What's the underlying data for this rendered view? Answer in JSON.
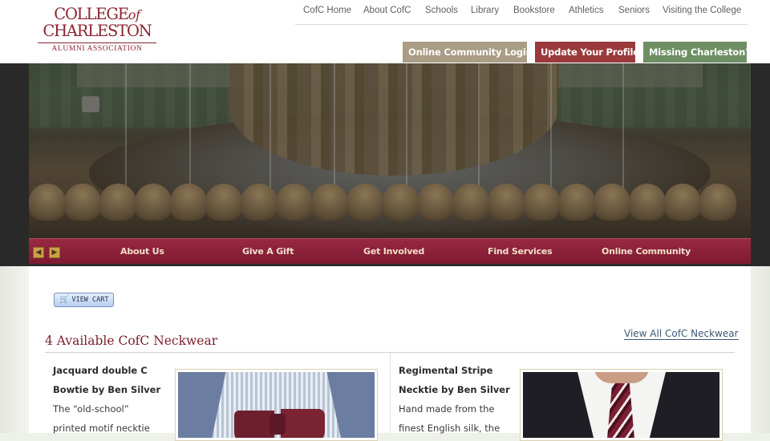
{
  "header": {
    "logo": {
      "line1_main": "COLLEGE",
      "line1_of": "of",
      "line2": "CHARLESTON",
      "sub": "ALUMNI ASSOCIATION"
    },
    "top_nav": [
      "CofC Home",
      "About CofC",
      "Schools",
      "Library",
      "Bookstore",
      "Athletics",
      "Seniors",
      "Visiting the College"
    ],
    "buttons": {
      "login": "Online Community Login",
      "update": "Update Your Profile",
      "missing": "Missing Charleston?"
    },
    "button_colors": {
      "login": "#a99d85",
      "update": "#9b3a3c",
      "missing": "#6e8f63"
    }
  },
  "hero": {
    "prev_icon": "arrow-left-icon",
    "next_icon": "arrow-right-icon"
  },
  "main_nav": [
    "About Us",
    "Give A Gift",
    "Get Involved",
    "Find Services",
    "Online Community"
  ],
  "content": {
    "view_cart": "VIEW CART",
    "section_title": "4 Available CofC Neckwear",
    "view_all": "View All CofC Neckwear",
    "products": [
      {
        "name_lines": [
          "Jacquard double C",
          "Bowtie by Ben Silver"
        ],
        "desc_lines": [
          "The “old-school”",
          "printed motif necktie"
        ]
      },
      {
        "name_lines": [
          "Regimental Stripe",
          "Necktie by Ben Silver"
        ],
        "desc_lines": [
          "Hand made from the",
          "finest English silk, the"
        ]
      }
    ]
  },
  "colors": {
    "brand_maroon": "#8b2332",
    "nav_maroon": "#7e1a32",
    "link_blue": "#3d5a78"
  }
}
